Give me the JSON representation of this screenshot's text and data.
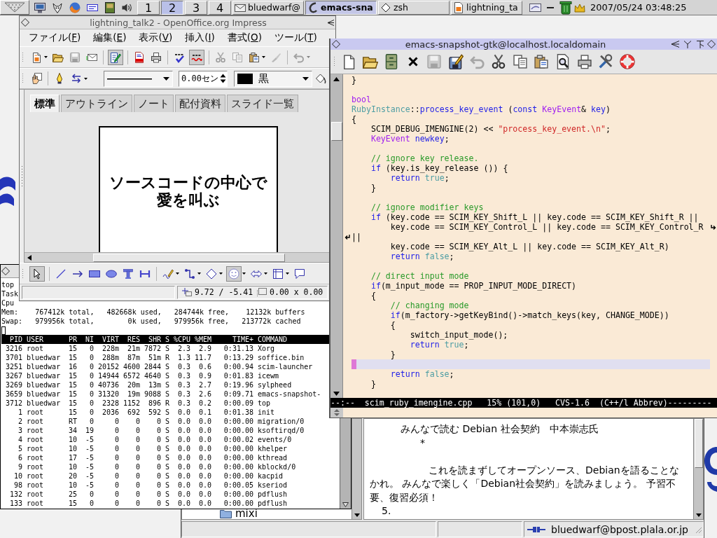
{
  "taskbar": {
    "workspaces": [
      {
        "label": "1",
        "selected": false
      },
      {
        "label": "2",
        "selected": true
      },
      {
        "label": "3",
        "selected": false
      },
      {
        "label": "4",
        "selected": false
      }
    ],
    "tasks": [
      {
        "label": "bluedwarf@",
        "selected": false
      },
      {
        "label": "emacs-sna",
        "selected": true
      },
      {
        "label": "zsh",
        "selected": false
      },
      {
        "label": "lightning_ta",
        "selected": false
      }
    ],
    "clock": "2007/05/24 03:48:25"
  },
  "impress": {
    "title": "lightning_talk2 - OpenOffice.org Impress",
    "menu": [
      "ファイル(F)",
      "編集(E)",
      "表示(V)",
      "挿入(I)",
      "書式(O)",
      "ツール(T)"
    ],
    "standard_toolbar": [
      [
        {
          "kind": "new",
          "dropdown": true,
          "disabled": false,
          "pressed": false
        },
        {
          "kind": "open",
          "disabled": false,
          "pressed": false
        },
        {
          "kind": "save",
          "disabled": true,
          "pressed": false
        },
        {
          "kind": "mail",
          "disabled": false,
          "pressed": false
        }
      ],
      [
        {
          "kind": "edit",
          "disabled": false,
          "pressed": true
        }
      ],
      [
        {
          "kind": "pdf",
          "disabled": false,
          "pressed": false
        },
        {
          "kind": "print",
          "disabled": false,
          "pressed": false
        }
      ],
      [
        {
          "kind": "spell",
          "disabled": false,
          "pressed": false
        },
        {
          "kind": "autospell",
          "disabled": false,
          "pressed": true
        }
      ],
      [
        {
          "kind": "cut",
          "disabled": true,
          "pressed": false
        },
        {
          "kind": "copy",
          "disabled": true,
          "pressed": false
        },
        {
          "kind": "paste",
          "dropdown": true,
          "disabled": false,
          "pressed": false
        },
        {
          "kind": "brush",
          "disabled": true,
          "pressed": false
        }
      ],
      [
        {
          "kind": "undo",
          "dropdown": true,
          "disabled": true,
          "pressed": false
        }
      ]
    ],
    "line_toolbar": [
      [
        {
          "kind": "hand",
          "disabled": false,
          "pressed": false
        }
      ],
      [
        {
          "kind": "pen",
          "disabled": false,
          "pressed": false
        },
        {
          "kind": "arrows",
          "dropdown": true,
          "disabled": false,
          "pressed": false
        },
        {
          "kind": "line_style",
          "disabled": false,
          "pressed": false
        },
        {
          "kind": "line_width",
          "value": "0.00セン",
          "disabled": false,
          "pressed": false
        },
        {
          "kind": "line_color",
          "value": "黒",
          "disabled": false,
          "pressed": false
        },
        {
          "kind": "fill",
          "disabled": false,
          "pressed": false
        }
      ]
    ],
    "view_tabs": [
      {
        "label": "標準",
        "selected": true
      },
      {
        "label": "アウトライン",
        "selected": false
      },
      {
        "label": "ノート",
        "selected": false
      },
      {
        "label": "配付資料",
        "selected": false
      },
      {
        "label": "スライド一覧",
        "selected": false
      }
    ],
    "slide": {
      "title": "ソースコードの中心で愛を叫ぶ"
    },
    "drawing_toolbar": [
      [
        {
          "kind": "select",
          "disabled": false,
          "pressed": true
        }
      ],
      [
        {
          "kind": "line",
          "disabled": false,
          "pressed": false
        },
        {
          "kind": "arrow",
          "disabled": false,
          "pressed": false
        },
        {
          "kind": "rect",
          "disabled": false,
          "pressed": false
        },
        {
          "kind": "ellipse",
          "disabled": false,
          "pressed": false
        },
        {
          "kind": "text",
          "disabled": false,
          "pressed": false
        },
        {
          "kind": "dimension",
          "disabled": false,
          "pressed": false
        }
      ],
      [
        {
          "kind": "curve",
          "dropdown": true,
          "disabled": false,
          "pressed": false
        },
        {
          "kind": "connector",
          "dropdown": true,
          "disabled": false,
          "pressed": false
        },
        {
          "kind": "diamond",
          "dropdown": true,
          "disabled": false,
          "pressed": false
        },
        {
          "kind": "smiley",
          "dropdown": true,
          "disabled": false,
          "pressed": true
        },
        {
          "kind": "dblarrow",
          "dropdown": true,
          "disabled": false,
          "pressed": false
        },
        {
          "kind": "frame",
          "dropdown": true,
          "disabled": false,
          "pressed": false
        },
        {
          "kind": "callout",
          "disabled": false,
          "pressed": false
        }
      ]
    ],
    "status": {
      "position": "9.72 / -5.41",
      "size": "0.00 x 0.00"
    }
  },
  "terminal": {
    "lines": [
      "top",
      "Task",
      "Cpu",
      "Mem:    767412k total,   482668k used,   284744k free,    12132k buffers",
      "Swap:   979956k total,        0k used,   979956k free,   213772k cached"
    ],
    "columns": [
      "PID",
      "USER",
      "PR",
      "NI",
      "VIRT",
      "RES",
      "SHR",
      "S",
      "%CPU",
      "%MEM",
      "TIME+",
      "COMMAND"
    ],
    "rows": [
      [
        "3216",
        "root",
        "15",
        "0",
        "228m",
        "21m",
        "7872",
        "S",
        "2.3",
        "2.9",
        "0:31.13",
        "Xorg"
      ],
      [
        "3701",
        "bluedwar",
        "15",
        "0",
        "288m",
        "87m",
        "51m",
        "R",
        "1.3",
        "11.7",
        "0:13.29",
        "soffice.bin"
      ],
      [
        "3251",
        "bluedwar",
        "16",
        "0",
        "20152",
        "4600",
        "2844",
        "S",
        "0.3",
        "0.6",
        "0:00.94",
        "scim-launcher"
      ],
      [
        "3267",
        "bluedwar",
        "15",
        "0",
        "14944",
        "6572",
        "4640",
        "S",
        "0.3",
        "0.9",
        "0:01.83",
        "icewm"
      ],
      [
        "3269",
        "bluedwar",
        "15",
        "0",
        "40736",
        "20m",
        "13m",
        "S",
        "0.3",
        "2.7",
        "0:19.96",
        "sylpheed"
      ],
      [
        "3659",
        "bluedwar",
        "15",
        "0",
        "31320",
        "19m",
        "9088",
        "S",
        "0.3",
        "2.6",
        "0:09.71",
        "emacs-snapshot-"
      ],
      [
        "3712",
        "bluedwar",
        "15",
        "0",
        "2328",
        "1152",
        "896",
        "R",
        "0.3",
        "0.2",
        "0:00.09",
        "top"
      ],
      [
        "1",
        "root",
        "15",
        "0",
        "2036",
        "692",
        "592",
        "S",
        "0.0",
        "0.1",
        "0:01.38",
        "init"
      ],
      [
        "2",
        "root",
        "RT",
        "0",
        "0",
        "0",
        "0",
        "S",
        "0.0",
        "0.0",
        "0:00.00",
        "migration/0"
      ],
      [
        "3",
        "root",
        "34",
        "19",
        "0",
        "0",
        "0",
        "S",
        "0.0",
        "0.0",
        "0:00.00",
        "ksoftirqd/0"
      ],
      [
        "4",
        "root",
        "10",
        "-5",
        "0",
        "0",
        "0",
        "S",
        "0.0",
        "0.0",
        "0:00.02",
        "events/0"
      ],
      [
        "5",
        "root",
        "10",
        "-5",
        "0",
        "0",
        "0",
        "S",
        "0.0",
        "0.0",
        "0:00.00",
        "khelper"
      ],
      [
        "6",
        "root",
        "17",
        "-5",
        "0",
        "0",
        "0",
        "S",
        "0.0",
        "0.0",
        "0:00.00",
        "kthread"
      ],
      [
        "9",
        "root",
        "10",
        "-5",
        "0",
        "0",
        "0",
        "S",
        "0.0",
        "0.0",
        "0:00.00",
        "kblockd/0"
      ],
      [
        "10",
        "root",
        "20",
        "-5",
        "0",
        "0",
        "0",
        "S",
        "0.0",
        "0.0",
        "0:00.00",
        "kacpid"
      ],
      [
        "98",
        "root",
        "10",
        "-5",
        "0",
        "0",
        "0",
        "S",
        "0.0",
        "0.0",
        "0:00.05",
        "kseriod"
      ],
      [
        "132",
        "root",
        "25",
        "0",
        "0",
        "0",
        "0",
        "S",
        "0.0",
        "0.0",
        "0:00.00",
        "pdflush"
      ],
      [
        "133",
        "root",
        "15",
        "0",
        "0",
        "0",
        "0",
        "S",
        "0.0",
        "0.0",
        "0:00.00",
        "pdflush"
      ]
    ]
  },
  "emacs": {
    "title": "emacs-snapshot-gtk@localhost.localdomain",
    "toolbar": [
      {
        "kind": "new",
        "disabled": false,
        "pressed": false
      },
      {
        "kind": "open",
        "disabled": false,
        "pressed": false
      },
      {
        "kind": "dired",
        "disabled": false,
        "pressed": false
      },
      {
        "kind": "close",
        "disabled": false,
        "pressed": false
      },
      {
        "kind": "save",
        "disabled": true,
        "pressed": false
      },
      {
        "kind": "saveas",
        "disabled": false,
        "pressed": false
      },
      {
        "kind": "undo",
        "disabled": true,
        "pressed": false
      },
      {
        "kind": "cut",
        "disabled": false,
        "pressed": false
      },
      {
        "kind": "copy",
        "disabled": false,
        "pressed": false
      },
      {
        "kind": "paste",
        "disabled": false,
        "pressed": false
      },
      {
        "kind": "search",
        "disabled": false,
        "pressed": false
      },
      {
        "kind": "print",
        "disabled": false,
        "pressed": false
      },
      {
        "kind": "customize",
        "disabled": false,
        "pressed": false
      },
      {
        "kind": "help",
        "disabled": false,
        "pressed": false
      }
    ],
    "code": [
      {
        "kind": "text",
        "tokens": [
          {
            "kind": "plain",
            "text": "}"
          }
        ]
      },
      {
        "kind": "blank"
      },
      {
        "kind": "text",
        "tokens": [
          {
            "kind": "type",
            "text": "bool"
          }
        ]
      },
      {
        "kind": "text",
        "tokens": [
          {
            "kind": "constant",
            "text": "RubyInstance"
          },
          {
            "kind": "plain",
            "text": "::"
          },
          {
            "kind": "name",
            "text": "process_key_event"
          },
          {
            "kind": "plain",
            "text": " ("
          },
          {
            "kind": "keyword",
            "text": "const "
          },
          {
            "kind": "type",
            "text": "KeyEvent"
          },
          {
            "kind": "plain",
            "text": "& "
          },
          {
            "kind": "name",
            "text": "key"
          },
          {
            "kind": "plain",
            "text": ")"
          }
        ]
      },
      {
        "kind": "text",
        "tokens": [
          {
            "kind": "plain",
            "text": "{"
          }
        ]
      },
      {
        "kind": "text",
        "tokens": [
          {
            "kind": "plain",
            "text": "    SCIM_DEBUG_IMENGINE(2) << "
          },
          {
            "kind": "string",
            "text": "\"process_key_event.\\n\""
          },
          {
            "kind": "plain",
            "text": ";"
          }
        ]
      },
      {
        "kind": "text",
        "tokens": [
          {
            "kind": "type",
            "text": "    KeyEvent "
          },
          {
            "kind": "name",
            "text": "newkey"
          },
          {
            "kind": "plain",
            "text": ";"
          }
        ]
      },
      {
        "kind": "blank"
      },
      {
        "kind": "text",
        "tokens": [
          {
            "kind": "comment",
            "text": "    // ignore key release."
          }
        ]
      },
      {
        "kind": "text",
        "tokens": [
          {
            "kind": "keyword",
            "text": "    if"
          },
          {
            "kind": "plain",
            "text": " (key.is_key_release ()) {"
          }
        ]
      },
      {
        "kind": "text",
        "tokens": [
          {
            "kind": "keyword",
            "text": "        return "
          },
          {
            "kind": "constant",
            "text": "true"
          },
          {
            "kind": "plain",
            "text": ";"
          }
        ]
      },
      {
        "kind": "text",
        "tokens": [
          {
            "kind": "plain",
            "text": "    }"
          }
        ]
      },
      {
        "kind": "blank"
      },
      {
        "kind": "text",
        "tokens": [
          {
            "kind": "comment",
            "text": "    // ignore modifier keys"
          }
        ]
      },
      {
        "kind": "text",
        "tokens": [
          {
            "kind": "keyword",
            "text": "    if"
          },
          {
            "kind": "plain",
            "text": " (key.code == SCIM_KEY_Shift_L || key.code == SCIM_KEY_Shift_R ||"
          }
        ]
      },
      {
        "kind": "wrap_start",
        "tokens": [
          {
            "kind": "plain",
            "text": "        key.code == SCIM_KEY_Control_L || key.code == SCIM_KEY_Control_R"
          }
        ]
      },
      {
        "kind": "wrap_end",
        "tokens": [
          {
            "kind": "plain",
            "text": "||"
          }
        ]
      },
      {
        "kind": "text",
        "tokens": [
          {
            "kind": "plain",
            "text": "        key.code == SCIM_KEY_Alt_L || key.code == SCIM_KEY_Alt_R)"
          }
        ]
      },
      {
        "kind": "text",
        "tokens": [
          {
            "kind": "keyword",
            "text": "        return "
          },
          {
            "kind": "constant",
            "text": "false"
          },
          {
            "kind": "plain",
            "text": ";"
          }
        ]
      },
      {
        "kind": "blank"
      },
      {
        "kind": "text",
        "tokens": [
          {
            "kind": "comment",
            "text": "    // direct input mode"
          }
        ]
      },
      {
        "kind": "text",
        "tokens": [
          {
            "kind": "keyword",
            "text": "    if"
          },
          {
            "kind": "plain",
            "text": "(m_input_mode == PROP_INPUT_MODE_DIRECT)"
          }
        ]
      },
      {
        "kind": "text",
        "tokens": [
          {
            "kind": "plain",
            "text": "    {"
          }
        ]
      },
      {
        "kind": "text",
        "tokens": [
          {
            "kind": "comment",
            "text": "        // changing mode"
          }
        ]
      },
      {
        "kind": "text",
        "tokens": [
          {
            "kind": "keyword",
            "text": "        if"
          },
          {
            "kind": "plain",
            "text": "(m_factory->getKeyBind()->match_keys(key, CHANGE_MODE))"
          }
        ]
      },
      {
        "kind": "text",
        "tokens": [
          {
            "kind": "plain",
            "text": "        {"
          }
        ]
      },
      {
        "kind": "text",
        "tokens": [
          {
            "kind": "plain",
            "text": "            switch_input_mode();"
          }
        ]
      },
      {
        "kind": "text",
        "tokens": [
          {
            "kind": "keyword",
            "text": "            return "
          },
          {
            "kind": "constant",
            "text": "true"
          },
          {
            "kind": "plain",
            "text": ";"
          }
        ]
      },
      {
        "kind": "text",
        "tokens": [
          {
            "kind": "plain",
            "text": "        }"
          }
        ]
      },
      {
        "kind": "cursor"
      },
      {
        "kind": "text",
        "tokens": [
          {
            "kind": "keyword",
            "text": "        return "
          },
          {
            "kind": "constant",
            "text": "false"
          },
          {
            "kind": "plain",
            "text": ";"
          }
        ]
      },
      {
        "kind": "text",
        "tokens": [
          {
            "kind": "plain",
            "text": "    }"
          }
        ]
      }
    ],
    "mode_line": "--:--  scim_ruby_imengine.cpp   15% (101,0)   CVS-1.6  (C++/l Abbrev)---------"
  },
  "mail": {
    "folders": [
      {
        "label": "mixi"
      }
    ],
    "message": [
      {
        "kind": "heading",
        "text": "みんなで読む Debian 社会契約　中本崇志氏"
      },
      {
        "kind": "bullet",
        "text": "*"
      },
      {
        "kind": "paragraph",
        "text": "これを読まずしてオープンソース、Debianを語ることなかれ。 みんなで楽しく「Debian社会契約」を読みましょう。 予習不要、復習必須！"
      },
      {
        "kind": "number",
        "text": "5."
      }
    ],
    "account": "bluedwarf@bpost.plala.or.jp"
  }
}
